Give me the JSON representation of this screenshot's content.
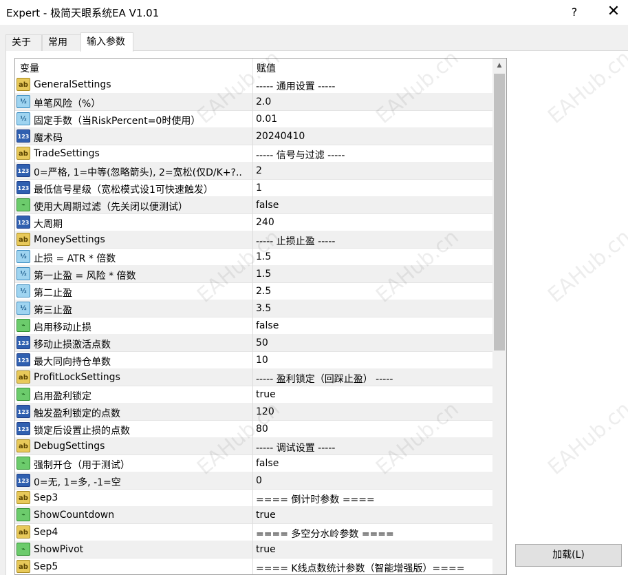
{
  "window": {
    "title": "Expert - 极简天眼系统EA V1.01",
    "help_label": "?",
    "close_label": "✕"
  },
  "tabs": [
    {
      "label": "关于"
    },
    {
      "label": "常用"
    },
    {
      "label": "输入参数"
    }
  ],
  "grid": {
    "col_variable": "变量",
    "col_value": "赋值",
    "rows": [
      {
        "type": "ab",
        "name": "GeneralSettings",
        "value": "----- 通用设置 -----"
      },
      {
        "type": "dbl",
        "name": "单笔风险（%）",
        "value": "2.0"
      },
      {
        "type": "dbl",
        "name": "固定手数（当RiskPercent=0时使用）",
        "value": "0.01"
      },
      {
        "type": "int",
        "name": "魔术码",
        "value": "20240410"
      },
      {
        "type": "ab",
        "name": "TradeSettings",
        "value": "----- 信号与过滤 -----"
      },
      {
        "type": "int",
        "name": "0=严格, 1=中等(忽略箭头), 2=宽松(仅D/K+?..",
        "value": "2"
      },
      {
        "type": "int",
        "name": "最低信号星级（宽松模式设1可快速触发）",
        "value": "1"
      },
      {
        "type": "bool",
        "name": "使用大周期过滤（先关闭以便测试）",
        "value": "false"
      },
      {
        "type": "int",
        "name": "大周期",
        "value": "240"
      },
      {
        "type": "ab",
        "name": "MoneySettings",
        "value": "----- 止损止盈 -----"
      },
      {
        "type": "dbl",
        "name": "止损 = ATR * 倍数",
        "value": "1.5"
      },
      {
        "type": "dbl",
        "name": "第一止盈 = 风险 * 倍数",
        "value": "1.5"
      },
      {
        "type": "dbl",
        "name": "第二止盈",
        "value": "2.5"
      },
      {
        "type": "dbl",
        "name": "第三止盈",
        "value": "3.5"
      },
      {
        "type": "bool",
        "name": "启用移动止损",
        "value": "false"
      },
      {
        "type": "int",
        "name": "移动止损激活点数",
        "value": "50"
      },
      {
        "type": "int",
        "name": "最大同向持仓单数",
        "value": "10"
      },
      {
        "type": "ab",
        "name": "ProfitLockSettings",
        "value": "----- 盈利锁定（回踩止盈） -----"
      },
      {
        "type": "bool",
        "name": "启用盈利锁定",
        "value": "true"
      },
      {
        "type": "int",
        "name": "触发盈利锁定的点数",
        "value": "120"
      },
      {
        "type": "int",
        "name": "锁定后设置止损的点数",
        "value": "80"
      },
      {
        "type": "ab",
        "name": "DebugSettings",
        "value": "----- 调试设置 -----"
      },
      {
        "type": "bool",
        "name": "强制开仓（用于测试）",
        "value": "false"
      },
      {
        "type": "int",
        "name": "0=无, 1=多, -1=空",
        "value": "0"
      },
      {
        "type": "ab",
        "name": "Sep3",
        "value": "==== 倒计时参数 ===="
      },
      {
        "type": "bool",
        "name": "ShowCountdown",
        "value": "true"
      },
      {
        "type": "ab",
        "name": "Sep4",
        "value": "==== 多空分水岭参数 ===="
      },
      {
        "type": "bool",
        "name": "ShowPivot",
        "value": "true"
      },
      {
        "type": "ab",
        "name": "Sep5",
        "value": "==== K线点数统计参数（智能增强版）===="
      }
    ]
  },
  "icon_glyphs": {
    "ab": "ab",
    "dbl": "½",
    "int": "123",
    "bool": "⌁"
  },
  "buttons": {
    "load": "加载(L)"
  },
  "watermark": "EAHub.cn"
}
